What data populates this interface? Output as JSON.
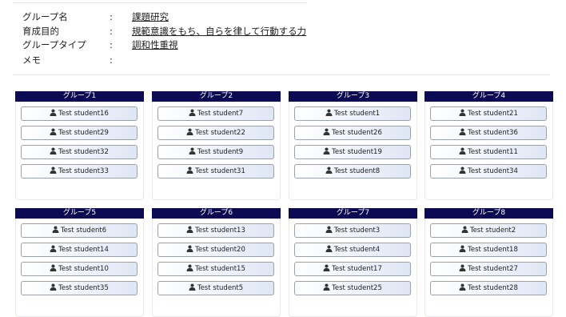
{
  "info": {
    "rows": [
      {
        "label": "グループ名",
        "colon": ":",
        "value": "課題研究"
      },
      {
        "label": "育成目的",
        "colon": ":",
        "value": "規範意識をもち、自らを律して行動する力"
      },
      {
        "label": "グループタイプ",
        "colon": ":",
        "value": "調和性重視"
      },
      {
        "label": "メモ",
        "colon": ":",
        "value": ""
      }
    ]
  },
  "groups": [
    {
      "name": "グループ1",
      "students": [
        "Test student16",
        "Test student29",
        "Test student32",
        "Test student33"
      ]
    },
    {
      "name": "グループ2",
      "students": [
        "Test student7",
        "Test student22",
        "Test student9",
        "Test student31"
      ]
    },
    {
      "name": "グループ3",
      "students": [
        "Test student1",
        "Test student26",
        "Test student19",
        "Test student8"
      ]
    },
    {
      "name": "グループ4",
      "students": [
        "Test student21",
        "Test student36",
        "Test student11",
        "Test student34"
      ]
    },
    {
      "name": "グループ5",
      "students": [
        "Test student6",
        "Test student14",
        "Test student10",
        "Test student35"
      ]
    },
    {
      "name": "グループ6",
      "students": [
        "Test student13",
        "Test student20",
        "Test student15",
        "Test student5"
      ]
    },
    {
      "name": "グループ7",
      "students": [
        "Test student3",
        "Test student4",
        "Test student17",
        "Test student25"
      ]
    },
    {
      "name": "グループ8",
      "students": [
        "Test student2",
        "Test student18",
        "Test student27",
        "Test student28"
      ]
    }
  ],
  "colors": {
    "group_header": "#0c0a52",
    "student_border": "#9aa0ad"
  },
  "icons": {
    "student": "person-icon"
  }
}
